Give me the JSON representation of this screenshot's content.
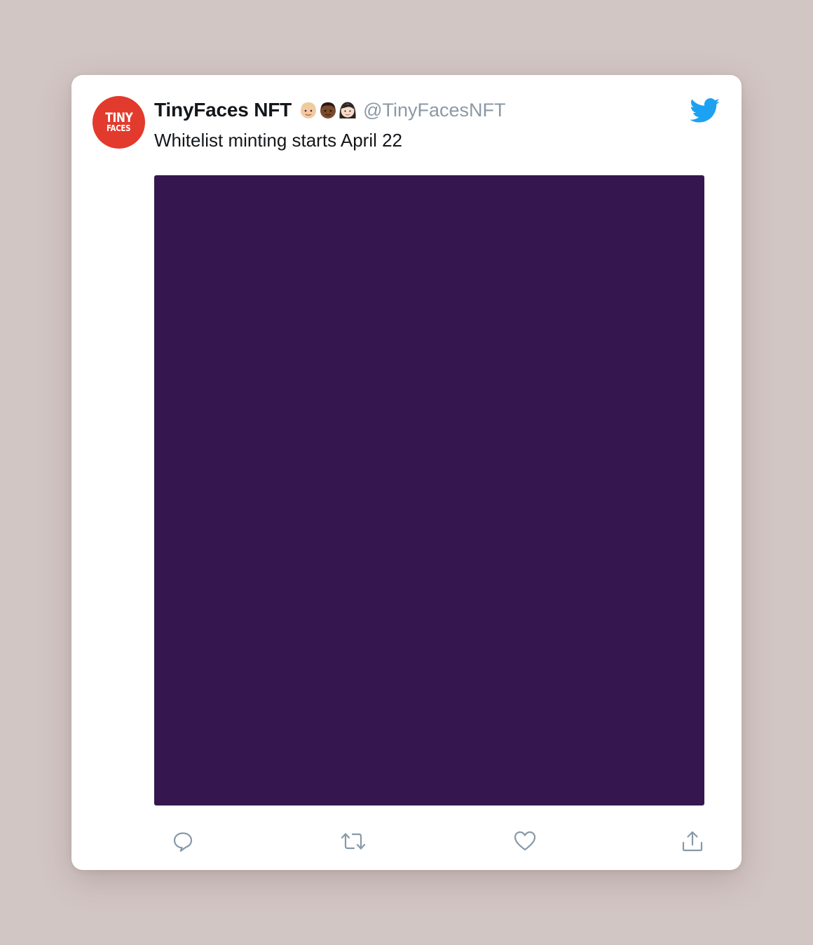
{
  "tweet": {
    "avatar": {
      "line1": "TINY",
      "line2": "FACES",
      "color": "#e23a2c"
    },
    "display_name": "TinyFaces NFT",
    "name_emojis": [
      "light-skin-face-icon",
      "dark-skin-face-icon",
      "woman-face-icon"
    ],
    "handle": "@TinyFacesNFT",
    "text": "Whitelist minting starts April 22",
    "media_color": "#36164e",
    "platform_icon": "twitter-bird-icon",
    "brand_color": "#1da1f2",
    "actions": [
      {
        "name": "reply",
        "icon": "reply-icon"
      },
      {
        "name": "retweet",
        "icon": "retweet-icon"
      },
      {
        "name": "like",
        "icon": "heart-icon"
      },
      {
        "name": "share",
        "icon": "share-icon"
      }
    ]
  }
}
